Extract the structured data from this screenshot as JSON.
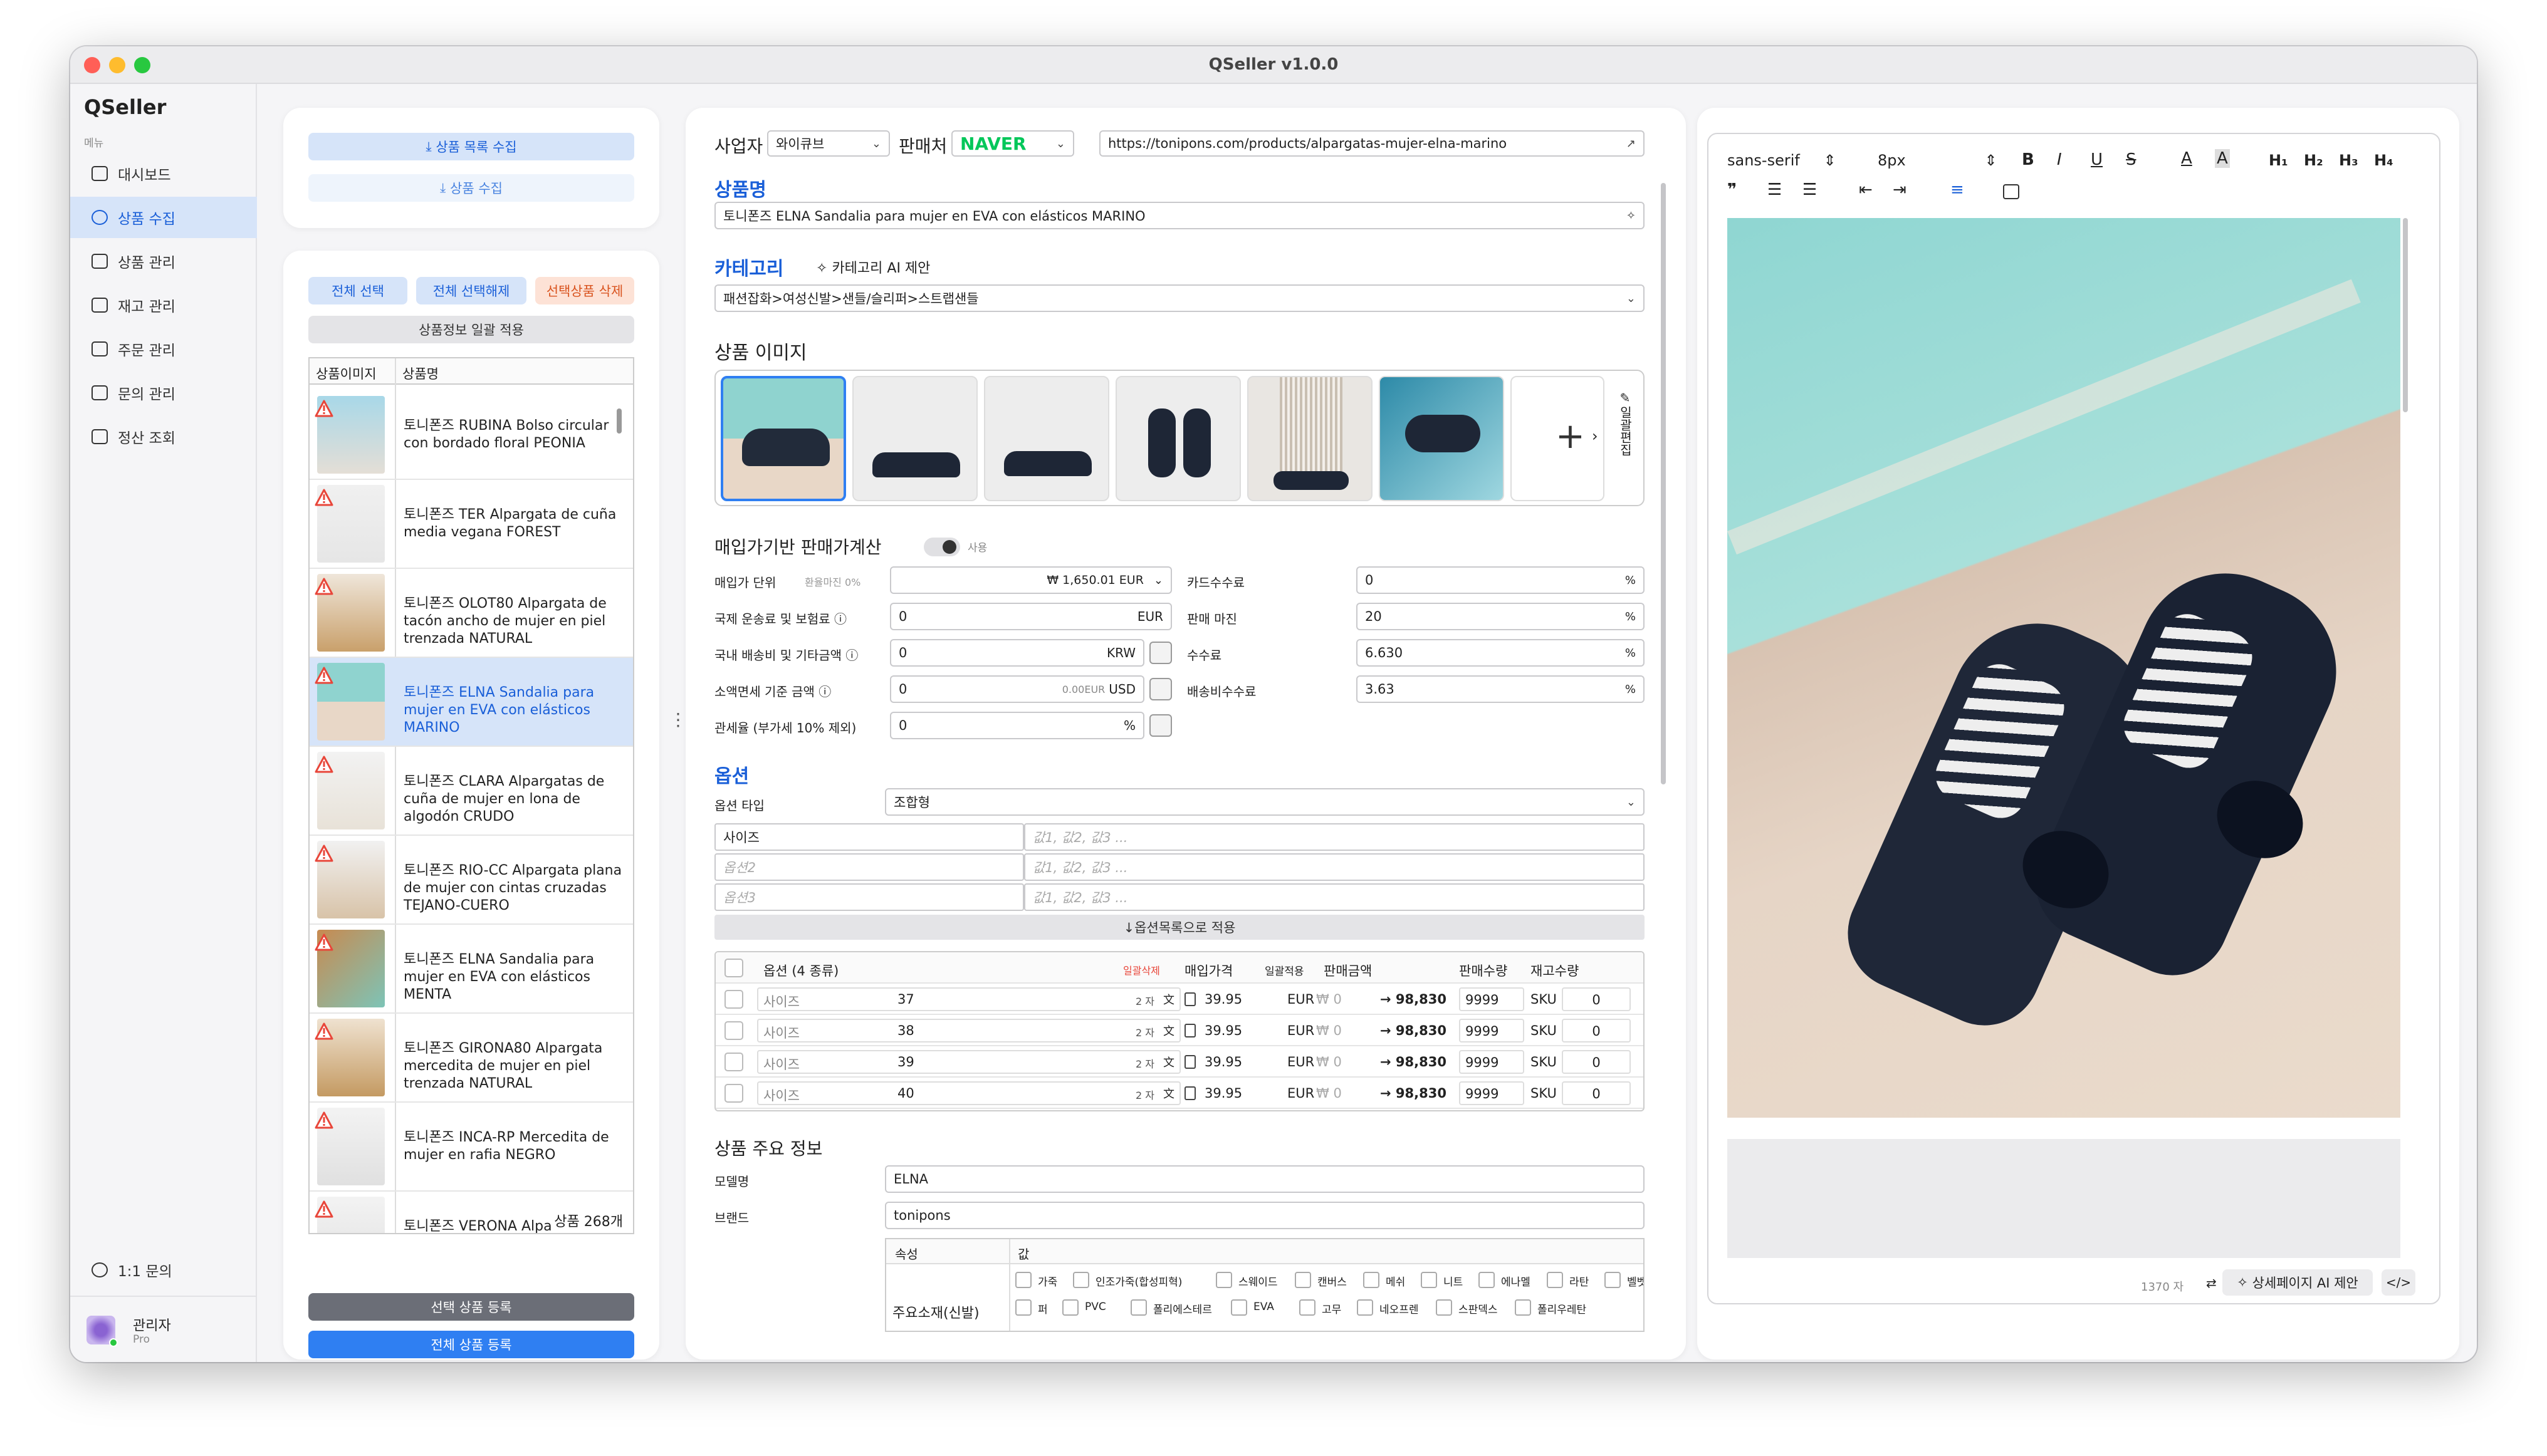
{
  "window": {
    "title": "QSeller v1.0.0"
  },
  "sidebar": {
    "brand": "QSeller",
    "menu_label": "메뉴",
    "items": [
      {
        "label": "대시보드"
      },
      {
        "label": "상품 수집"
      },
      {
        "label": "상품 관리"
      },
      {
        "label": "재고 관리"
      },
      {
        "label": "주문 관리"
      },
      {
        "label": "문의 관리"
      },
      {
        "label": "정산 조회"
      }
    ],
    "support": "1:1 문의",
    "user_name": "관리자",
    "user_plan": "Pro"
  },
  "collect": {
    "list_btn": "상품 목록 수집",
    "item_btn": "상품 수집"
  },
  "list_panel": {
    "select_all": "전체 선택",
    "deselect_all": "전체 선택해제",
    "delete_selected": "선택상품 삭제",
    "bulk_apply": "상품정보 일괄 적용",
    "col_image": "상품이미지",
    "col_name": "상품명",
    "items": [
      {
        "name": "토니폰즈 RUBINA Bolso circular con bordado floral PEONIA"
      },
      {
        "name": "토니폰즈 TER Alpargata de cuña media vegana FOREST"
      },
      {
        "name": "토니폰즈 OLOT80 Alpargata de tacón ancho de mujer en piel trenzada NATURAL"
      },
      {
        "name": "토니폰즈 ELNA Sandalia para mujer en EVA con elásticos MARINO"
      },
      {
        "name": "토니폰즈 CLARA Alpargatas de cuña de mujer en lona de algodón CRUDO"
      },
      {
        "name": "토니폰즈 RIO-CC Alpargata plana de mujer con cintas cruzadas TEJANO-CUERO"
      },
      {
        "name": "토니폰즈 ELNA Sandalia para mujer en EVA con elásticos MENTA"
      },
      {
        "name": "토니폰즈 GIRONA80 Alpargata mercedita de mujer en piel trenzada NATURAL"
      },
      {
        "name": "토니폰즈 INCA-RP Mercedita de mujer en rafia NEGRO"
      },
      {
        "name": "토니폰즈 VERONA Alpa"
      }
    ],
    "count": "상품 268개",
    "register_selected": "선택 상품 등록",
    "register_all": "전체 상품 등록"
  },
  "form": {
    "business_label": "사업자",
    "business_value": "와이큐브",
    "seller_label": "판매처",
    "seller_value": "NAVER",
    "url": "https://tonipons.com/products/alpargatas-mujer-elna-marino",
    "name_title": "상품명",
    "name_value": "토니폰즈 ELNA Sandalia para mujer en EVA con elásticos MARINO",
    "category_title": "카테고리",
    "category_ai": "카테고리 AI 제안",
    "category_value": "패션잡화>여성신발>샌들/슬리퍼>스트랩샌들",
    "images_title": "상품 이미지",
    "bulk_edit": "일괄편집",
    "price_title": "매입가기반 판매가계산",
    "price_toggle": "사용",
    "unit_label": "매입가 단위",
    "exchange_note": "환율마진 0%",
    "unit_value": "₩ 1,650.01 EUR",
    "shipping_label": "국제 운송료 및 보험료",
    "shipping_value": "0",
    "shipping_unit": "EUR",
    "domestic_label": "국내 배송비 및 기타금액",
    "domestic_value": "0",
    "domestic_unit": "KRW",
    "dutyfree_label": "소액면세 기준 금액",
    "dutyfree_value": "0",
    "dutyfree_note": "0.00EUR",
    "dutyfree_unit": "USD",
    "tariff_label": "관세율 (부가세 10% 제외)",
    "tariff_value": "0",
    "tariff_unit": "%",
    "card_fee_label": "카드수수료",
    "card_fee_value": "0",
    "margin_label": "판매 마진",
    "margin_value": "20",
    "fee_label": "수수료",
    "fee_value": "6.630",
    "ship_fee_label": "배송비수수료",
    "ship_fee_value": "3.63",
    "percent": "%",
    "options_title": "옵션",
    "option_type_label": "옵션 타입",
    "option_type_value": "조합형",
    "option_names": [
      {
        "name": "사이즈",
        "values": "값1, 값2, 값3 ..."
      },
      {
        "name": "옵션2",
        "values": "값1, 값2, 값3 ..."
      },
      {
        "name": "옵션3",
        "values": "값1, 값2, 값3 ..."
      }
    ],
    "apply_options": "↓옵션목록으로 적용",
    "opt_head": {
      "option": "옵션 (4 종류)",
      "bulk_delete": "일괄삭제",
      "buy_price": "매입가격",
      "bulk_apply": "일괄적용",
      "sell_price": "판매금액",
      "sell_qty": "판매수량",
      "stock": "재고수량"
    },
    "option_rows": [
      {
        "label": "사이즈",
        "value": "37",
        "count": "2 자",
        "price": "39.95",
        "cur": "EUR",
        "won": "₩ 0",
        "sell": "→ 98,830",
        "qty": "9999",
        "sku": "SKU",
        "stock": "0"
      },
      {
        "label": "사이즈",
        "value": "38",
        "count": "2 자",
        "price": "39.95",
        "cur": "EUR",
        "won": "₩ 0",
        "sell": "→ 98,830",
        "qty": "9999",
        "sku": "SKU",
        "stock": "0"
      },
      {
        "label": "사이즈",
        "value": "39",
        "count": "2 자",
        "price": "39.95",
        "cur": "EUR",
        "won": "₩ 0",
        "sell": "→ 98,830",
        "qty": "9999",
        "sku": "SKU",
        "stock": "0"
      },
      {
        "label": "사이즈",
        "value": "40",
        "count": "2 자",
        "price": "39.95",
        "cur": "EUR",
        "won": "₩ 0",
        "sell": "→ 98,830",
        "qty": "9999",
        "sku": "SKU",
        "stock": "0"
      }
    ],
    "info_title": "상품 주요 정보",
    "model_label": "모델명",
    "model_value": "ELNA",
    "brand_label": "브랜드",
    "brand_value": "tonipons",
    "attr_col": "속성",
    "value_col": "값",
    "material_label": "주요소재(신발)",
    "materials_row1": [
      "가죽",
      "인조가죽(합성피혁)",
      "스웨이드",
      "캔버스",
      "메쉬",
      "니트",
      "에나멜",
      "라탄",
      "벨벳"
    ],
    "materials_row2": [
      "퍼",
      "PVC",
      "폴리에스테르",
      "EVA",
      "고무",
      "네오프렌",
      "스판덱스",
      "폴리우레탄"
    ]
  },
  "editor": {
    "font": "sans-serif",
    "size": "8px",
    "char_count": "1370 자",
    "ai_detail": "상세페이지 AI 제안"
  },
  "colors": {
    "accent": "#1a5fd8",
    "naver": "#03c75a",
    "danger": "#e8463a"
  }
}
